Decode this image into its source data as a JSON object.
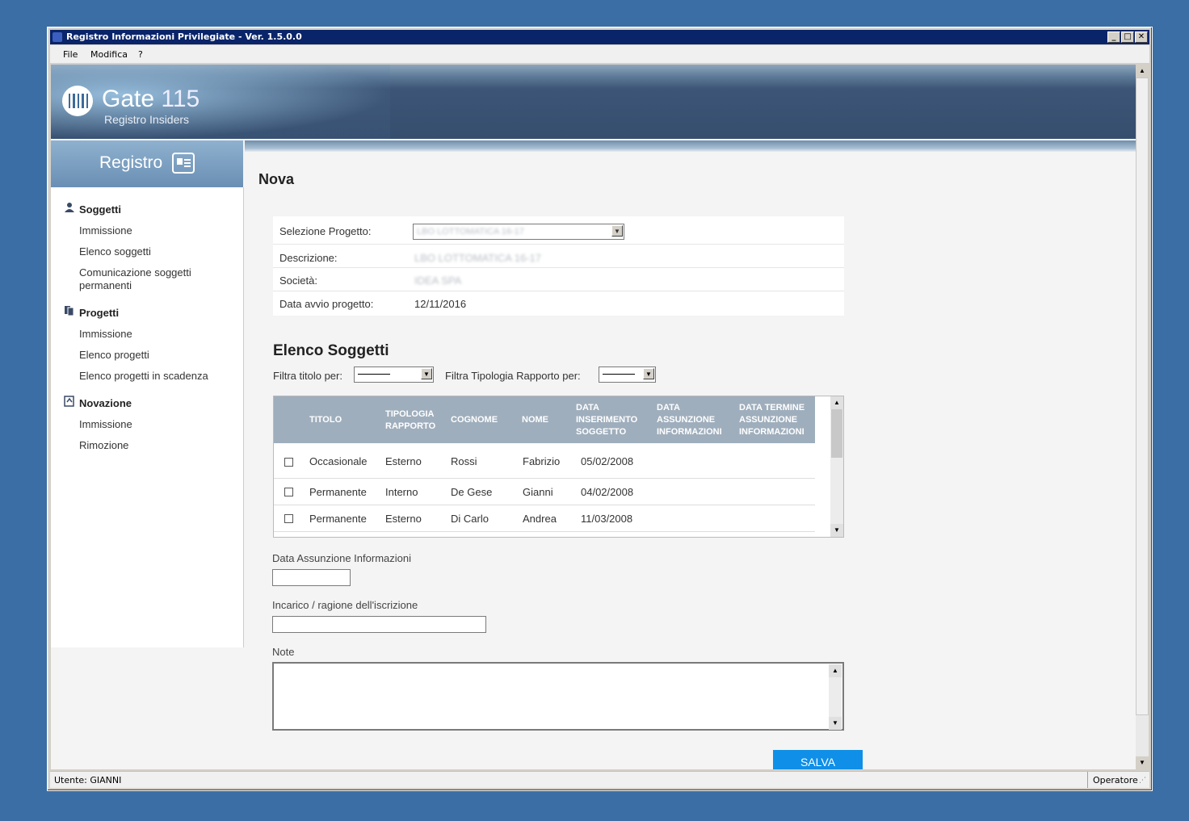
{
  "window": {
    "title": "Registro Informazioni Privilegiate - Ver. 1.5.0.0"
  },
  "menu": [
    "File",
    "Modifica",
    "?"
  ],
  "brand": {
    "name": "Gate",
    "number": "115",
    "subtitle": "Registro Insiders"
  },
  "sidebar": {
    "header": "Registro",
    "sections": [
      {
        "title": "Soggetti",
        "icon": "person-icon",
        "items": [
          "Immissione",
          "Elenco soggetti",
          "Comunicazione soggetti permanenti"
        ]
      },
      {
        "title": "Progetti",
        "icon": "documents-icon",
        "items": [
          "Immissione",
          "Elenco progetti",
          "Elenco progetti in scadenza"
        ]
      },
      {
        "title": "Novazione",
        "icon": "refresh-document-icon",
        "items": [
          "Immissione",
          "Rimozione"
        ]
      }
    ]
  },
  "page": {
    "title": "Nova"
  },
  "project_form": {
    "selection_label": "Selezione Progetto:",
    "selection_value": "LBO LOTTOMATICA 16-17",
    "description_label": "Descrizione:",
    "description_value": "LBO LOTTOMATICA 16-17",
    "company_label": "Società:",
    "company_value": "IDEA SPA",
    "start_label": "Data avvio progetto:",
    "start_value": "12/11/2016"
  },
  "subjects": {
    "title": "Elenco Soggetti",
    "filter_title_label": "Filtra titolo per:",
    "filter_type_label": "Filtra Tipologia Rapporto per:",
    "columns": [
      "TITOLO",
      "TIPOLOGIA RAPPORTO",
      "COGNOME",
      "NOME",
      "DATA INSERIMENTO SOGGETTO",
      "DATA ASSUNZIONE INFORMAZIONI",
      "DATA TERMINE ASSUNZIONE INFORMAZIONI"
    ],
    "rows": [
      [
        "Occasionale",
        "Esterno",
        "Rossi",
        "Fabrizio",
        "05/02/2008"
      ],
      [
        "Permanente",
        "Interno",
        "De Gese",
        "Gianni",
        "04/02/2008"
      ],
      [
        "Permanente",
        "Esterno",
        "Di Carlo",
        "Andrea",
        "11/03/2008"
      ]
    ]
  },
  "fields": {
    "assunzione_label": "Data Assunzione Informazioni",
    "incarico_label": "Incarico / ragione dell'iscrizione",
    "note_label": "Note"
  },
  "actions": {
    "save": "SALVA"
  },
  "status": {
    "user": "Utente: GIANNI",
    "role": "Operatore"
  }
}
